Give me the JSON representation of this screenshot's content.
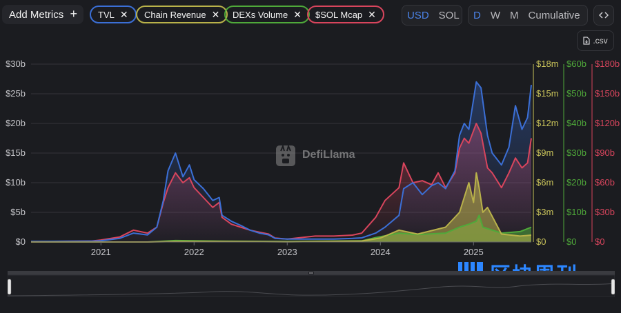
{
  "toolbar": {
    "add_metrics_label": "Add Metrics",
    "add_icon": "plus-icon",
    "chips": [
      {
        "label": "TVL",
        "color": "#3b6fd6"
      },
      {
        "label": "Chain Revenue",
        "color": "#b9b24a"
      },
      {
        "label": "DEXs Volume",
        "color": "#4fa93a"
      },
      {
        "label": "$SOL Mcap",
        "color": "#d9455d"
      }
    ],
    "currency_options": [
      "USD",
      "SOL"
    ],
    "currency_selected": "USD",
    "interval_options": [
      "D",
      "W",
      "M",
      "Cumulative"
    ],
    "interval_selected": "D",
    "embed_icon": "code-icon",
    "csv_label": ".csv",
    "csv_icon": "file-download-icon"
  },
  "watermark": "DefiLlama",
  "brand": "区块周刊",
  "slider_handle_icon": "drag-handle-icon",
  "chart_data": {
    "type": "line",
    "x_ticks": [
      "2021",
      "2022",
      "2023",
      "2024",
      "2025"
    ],
    "x_range": [
      2020.25,
      2025.62
    ],
    "axes": [
      {
        "series": "TVL",
        "color": "#9aa0ac",
        "max": 30,
        "ticks": [
          "$0",
          "$5b",
          "$10b",
          "$15b",
          "$20b",
          "$25b",
          "$30b"
        ]
      },
      {
        "series": "Chain Revenue",
        "color": "#c9c35a",
        "max": 18,
        "ticks": [
          "$0",
          "$3m",
          "$6m",
          "$9m",
          "$12m",
          "$15m",
          "$18m"
        ]
      },
      {
        "series": "DEXs Volume",
        "color": "#4fa93a",
        "max": 60,
        "ticks": [
          "$0",
          "$10b",
          "$20b",
          "$30b",
          "$40b",
          "$50b",
          "$60b"
        ]
      },
      {
        "series": "$SOL Mcap",
        "color": "#d9455d",
        "max": 180,
        "ticks": [
          "$0",
          "$30b",
          "$60b",
          "$90b",
          "$120b",
          "$150b",
          "$180b"
        ]
      }
    ],
    "grid": true,
    "series": [
      {
        "name": "TVL",
        "color": "#3b6fd6",
        "unit": "$b",
        "points": [
          [
            2020.25,
            0.1
          ],
          [
            2020.9,
            0.15
          ],
          [
            2021.0,
            0.2
          ],
          [
            2021.2,
            0.6
          ],
          [
            2021.35,
            1.5
          ],
          [
            2021.5,
            1.2
          ],
          [
            2021.6,
            2.5
          ],
          [
            2021.67,
            7
          ],
          [
            2021.72,
            12
          ],
          [
            2021.8,
            15
          ],
          [
            2021.88,
            11
          ],
          [
            2021.95,
            13
          ],
          [
            2022.0,
            10.5
          ],
          [
            2022.1,
            9
          ],
          [
            2022.2,
            7
          ],
          [
            2022.27,
            7.5
          ],
          [
            2022.3,
            4.5
          ],
          [
            2022.4,
            3.5
          ],
          [
            2022.5,
            2.8
          ],
          [
            2022.6,
            2
          ],
          [
            2022.7,
            1.5
          ],
          [
            2022.8,
            1.2
          ],
          [
            2022.87,
            0.6
          ],
          [
            2023.0,
            0.5
          ],
          [
            2023.3,
            0.5
          ],
          [
            2023.5,
            0.5
          ],
          [
            2023.7,
            0.6
          ],
          [
            2023.8,
            0.7
          ],
          [
            2023.95,
            1.5
          ],
          [
            2024.05,
            2.5
          ],
          [
            2024.2,
            4.5
          ],
          [
            2024.25,
            9
          ],
          [
            2024.35,
            10
          ],
          [
            2024.45,
            8
          ],
          [
            2024.55,
            9.5
          ],
          [
            2024.62,
            10
          ],
          [
            2024.7,
            9
          ],
          [
            2024.8,
            12
          ],
          [
            2024.85,
            18
          ],
          [
            2024.9,
            20
          ],
          [
            2024.95,
            19
          ],
          [
            2025.03,
            27
          ],
          [
            2025.08,
            26
          ],
          [
            2025.15,
            18
          ],
          [
            2025.2,
            15
          ],
          [
            2025.3,
            13
          ],
          [
            2025.38,
            16
          ],
          [
            2025.45,
            23
          ],
          [
            2025.52,
            19
          ],
          [
            2025.58,
            21
          ],
          [
            2025.62,
            26.5
          ]
        ]
      },
      {
        "name": "$SOL Mcap",
        "color": "#d9455d",
        "unit": "$b",
        "points": [
          [
            2020.25,
            0.5
          ],
          [
            2020.9,
            1
          ],
          [
            2021.0,
            2
          ],
          [
            2021.2,
            5
          ],
          [
            2021.35,
            12
          ],
          [
            2021.5,
            9
          ],
          [
            2021.6,
            15
          ],
          [
            2021.67,
            40
          ],
          [
            2021.72,
            55
          ],
          [
            2021.8,
            70
          ],
          [
            2021.88,
            60
          ],
          [
            2021.95,
            65
          ],
          [
            2022.0,
            55
          ],
          [
            2022.1,
            45
          ],
          [
            2022.2,
            35
          ],
          [
            2022.27,
            40
          ],
          [
            2022.3,
            25
          ],
          [
            2022.4,
            18
          ],
          [
            2022.5,
            15
          ],
          [
            2022.6,
            12
          ],
          [
            2022.7,
            10
          ],
          [
            2022.8,
            8
          ],
          [
            2022.87,
            4
          ],
          [
            2023.0,
            3
          ],
          [
            2023.3,
            6
          ],
          [
            2023.5,
            6
          ],
          [
            2023.7,
            7
          ],
          [
            2023.8,
            9
          ],
          [
            2023.95,
            25
          ],
          [
            2024.05,
            42
          ],
          [
            2024.2,
            55
          ],
          [
            2024.25,
            80
          ],
          [
            2024.35,
            60
          ],
          [
            2024.45,
            62
          ],
          [
            2024.55,
            58
          ],
          [
            2024.62,
            70
          ],
          [
            2024.7,
            55
          ],
          [
            2024.8,
            70
          ],
          [
            2024.85,
            95
          ],
          [
            2024.9,
            105
          ],
          [
            2024.95,
            100
          ],
          [
            2025.03,
            120
          ],
          [
            2025.08,
            110
          ],
          [
            2025.15,
            75
          ],
          [
            2025.2,
            70
          ],
          [
            2025.3,
            55
          ],
          [
            2025.38,
            70
          ],
          [
            2025.45,
            85
          ],
          [
            2025.52,
            75
          ],
          [
            2025.58,
            80
          ],
          [
            2025.62,
            105
          ]
        ]
      },
      {
        "name": "DEXs Volume",
        "color": "#4fa93a",
        "unit": "$b",
        "points": [
          [
            2020.25,
            0
          ],
          [
            2021.5,
            0
          ],
          [
            2021.8,
            0.5
          ],
          [
            2022.3,
            0.3
          ],
          [
            2023.0,
            0.2
          ],
          [
            2023.8,
            0.4
          ],
          [
            2023.95,
            1.5
          ],
          [
            2024.2,
            3
          ],
          [
            2024.4,
            2.5
          ],
          [
            2024.7,
            3
          ],
          [
            2024.85,
            5
          ],
          [
            2024.95,
            6
          ],
          [
            2025.03,
            7
          ],
          [
            2025.06,
            9
          ],
          [
            2025.1,
            5
          ],
          [
            2025.3,
            3
          ],
          [
            2025.5,
            3.5
          ],
          [
            2025.62,
            5
          ]
        ]
      },
      {
        "name": "Chain Revenue",
        "color": "#b9b24a",
        "unit": "$m",
        "points": [
          [
            2020.25,
            0
          ],
          [
            2021.5,
            0
          ],
          [
            2021.8,
            0.05
          ],
          [
            2022.3,
            0.05
          ],
          [
            2023.0,
            0.02
          ],
          [
            2023.8,
            0.1
          ],
          [
            2024.0,
            0.4
          ],
          [
            2024.2,
            1.2
          ],
          [
            2024.4,
            0.8
          ],
          [
            2024.7,
            1.5
          ],
          [
            2024.85,
            3
          ],
          [
            2024.95,
            6
          ],
          [
            2025.0,
            4
          ],
          [
            2025.03,
            7
          ],
          [
            2025.06,
            5.5
          ],
          [
            2025.1,
            3
          ],
          [
            2025.15,
            3.5
          ],
          [
            2025.3,
            0.8
          ],
          [
            2025.5,
            0.6
          ],
          [
            2025.62,
            0.7
          ]
        ]
      }
    ]
  }
}
